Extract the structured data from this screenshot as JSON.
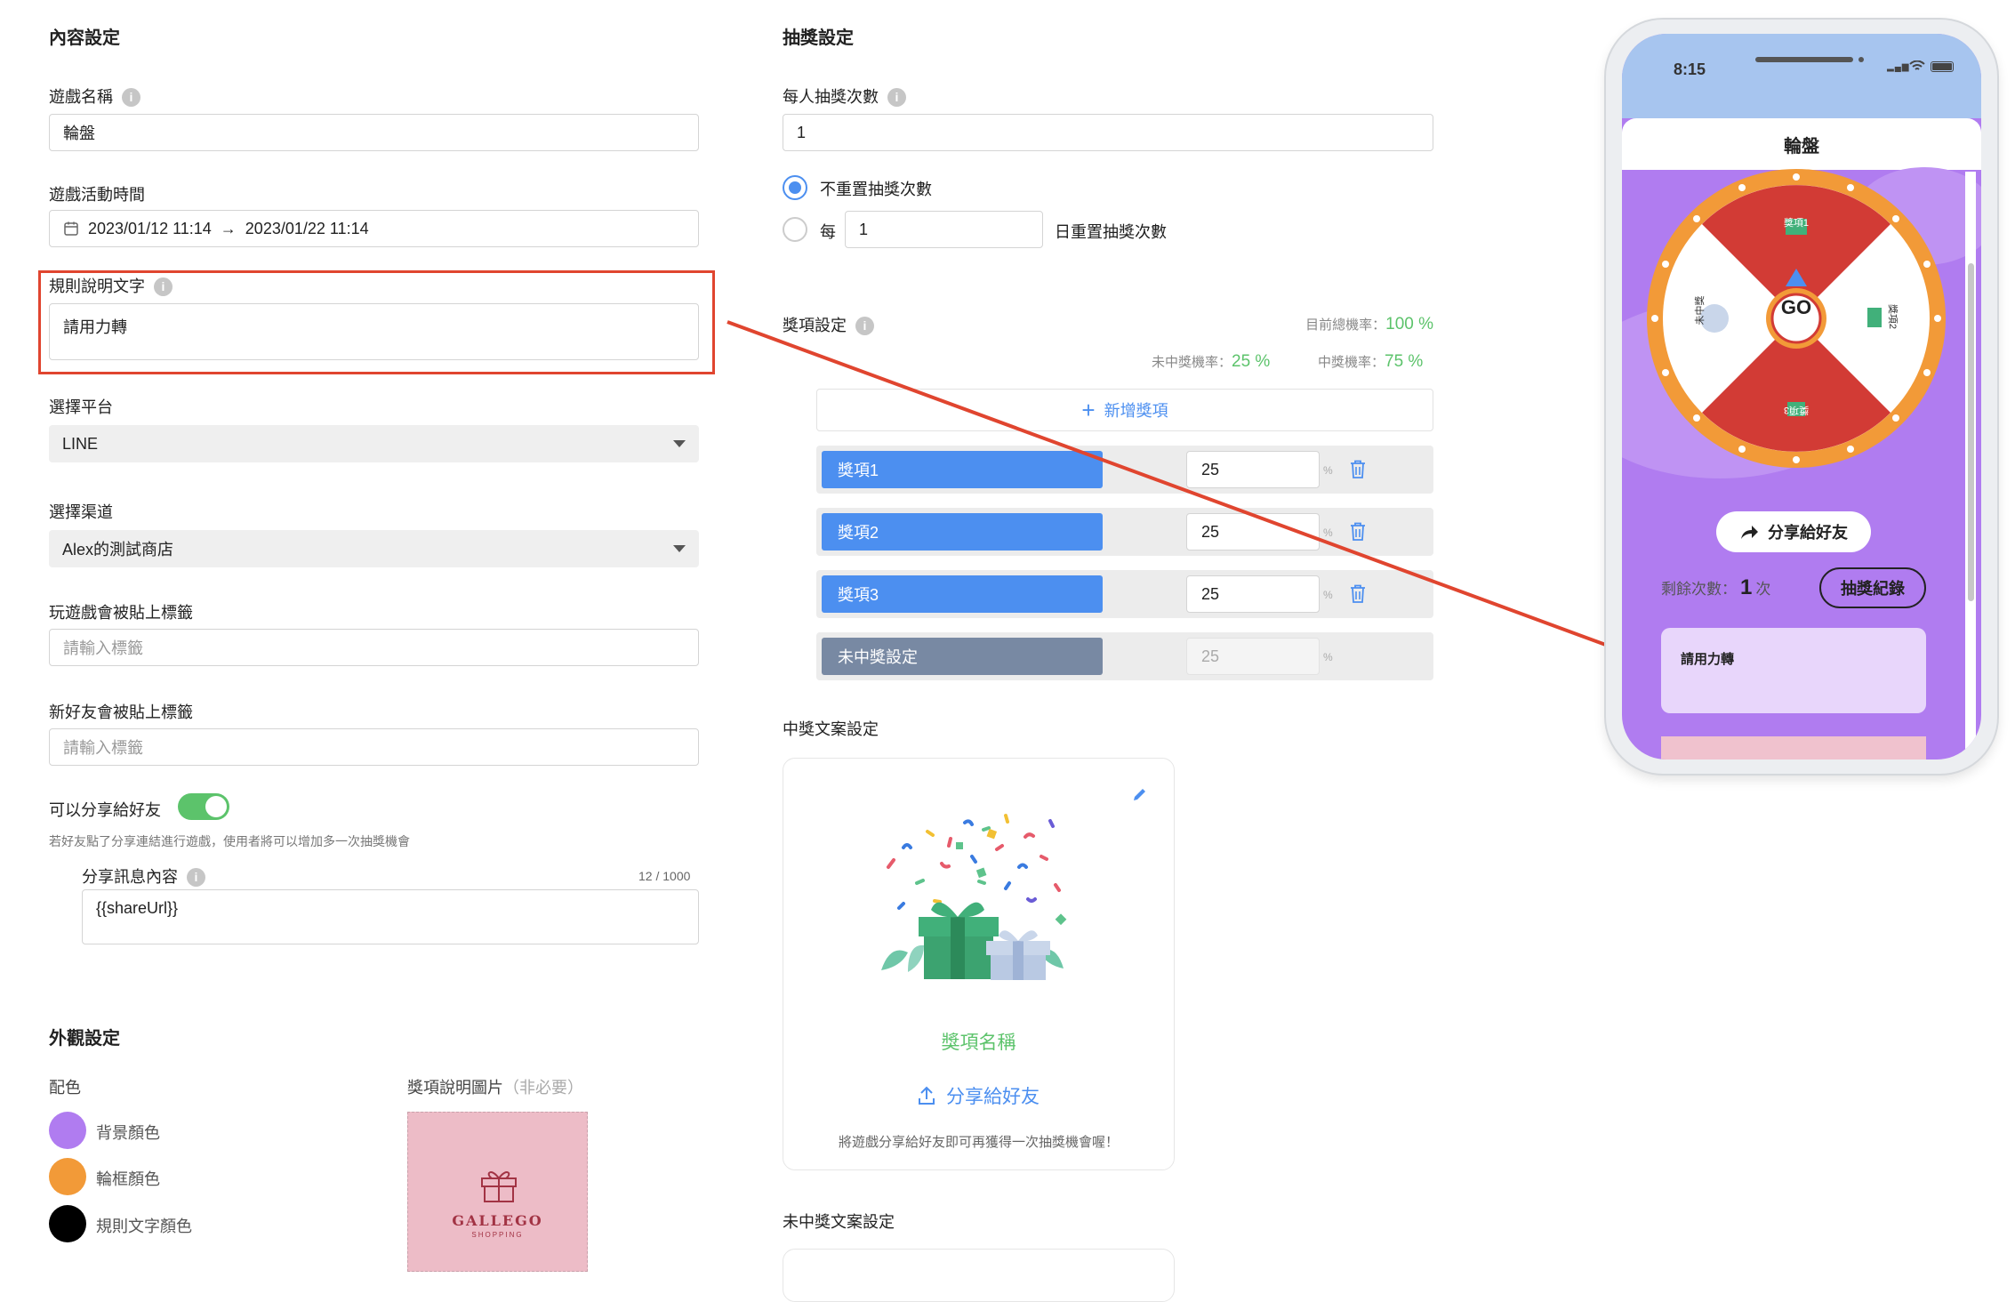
{
  "content_settings": {
    "heading": "內容設定",
    "game_name_label": "遊戲名稱",
    "game_name_value": "輪盤",
    "time_label": "遊戲活動時間",
    "time_start": "2023/01/12 11:14",
    "time_arrow": "→",
    "time_end": "2023/01/22 11:14",
    "rule_label": "規則說明文字",
    "rule_value": "請用力轉",
    "platform_label": "選擇平台",
    "platform_value": "LINE",
    "channel_label": "選擇渠道",
    "channel_value": "Alex的測試商店",
    "play_tag_label": "玩遊戲會被貼上標籤",
    "play_tag_placeholder": "請輸入標籤",
    "friend_tag_label": "新好友會被貼上標籤",
    "friend_tag_placeholder": "請輸入標籤",
    "share_label": "可以分享給好友",
    "share_enabled": true,
    "share_hint": "若好友點了分享連結進行遊戲，使用者將可以增加多一次抽獎機會",
    "share_msg_label": "分享訊息內容",
    "share_msg_count": "12 / 1000",
    "share_msg_value": "{{shareUrl}}"
  },
  "appearance": {
    "heading": "外觀設定",
    "colors_label": "配色",
    "colors": [
      {
        "label": "背景顏色",
        "color": "#b07cf0"
      },
      {
        "label": "輪框顏色",
        "color": "#f29a38"
      },
      {
        "label": "規則文字顏色",
        "color": "#000000"
      }
    ],
    "prize_image_label": "獎項說明圖片",
    "prize_image_optional": "（非必要）",
    "logo_brand": "GALLEGO",
    "logo_sub": "SHOPPING"
  },
  "draw_settings": {
    "heading": "抽獎設定",
    "per_person_label": "每人抽獎次數",
    "per_person_value": "1",
    "opt_no_reset": "不重置抽獎次數",
    "opt_every": "每",
    "every_value": "1",
    "opt_every_suffix": "日重置抽獎次數"
  },
  "prize_settings": {
    "heading": "獎項設定",
    "total_label": "目前總機率：",
    "total_value": "100 %",
    "miss_label": "未中獎機率：",
    "miss_value": "25 %",
    "hit_label": "中獎機率：",
    "hit_value": "75 %",
    "add_label": "新增獎項",
    "pct_unit": "%",
    "items": [
      {
        "name": "獎項1",
        "value": "25"
      },
      {
        "name": "獎項2",
        "value": "25"
      },
      {
        "name": "獎項3",
        "value": "25"
      }
    ],
    "miss_item": {
      "name": "未中獎設定",
      "value": "25"
    }
  },
  "win_copy": {
    "heading": "中獎文案設定",
    "prize_name": "獎項名稱",
    "share_button": "分享給好友",
    "note": "將遊戲分享給好友即可再獲得一次抽獎機會喔！"
  },
  "miss_copy": {
    "heading": "未中獎文案設定"
  },
  "phone": {
    "time": "8:15",
    "title": "輪盤",
    "wheel_labels": [
      "獎項1",
      "獎項2",
      "獎項3",
      "未中獎"
    ],
    "go": "GO",
    "share_button": "分享給好友",
    "remain_label": "剩餘次數：",
    "remain_value": "1",
    "remain_unit": "次",
    "records_button": "抽獎紀錄",
    "rule_text": "請用力轉"
  },
  "colors": {
    "accent_blue": "#4c8ff0",
    "green": "#5cc36b",
    "annotation_red": "#e0452f",
    "wheel_red": "#d23b35",
    "phone_purple": "#b07cf0"
  }
}
